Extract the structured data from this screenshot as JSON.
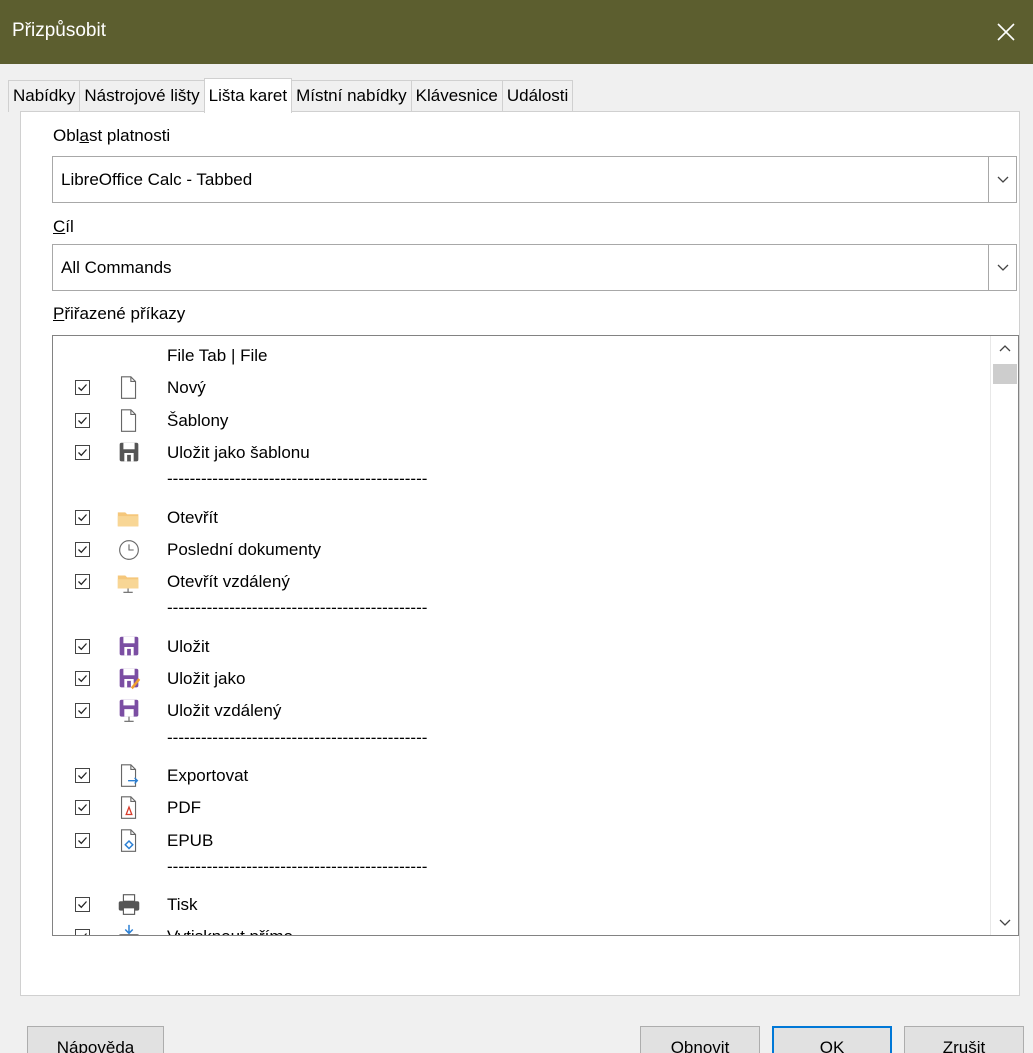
{
  "window": {
    "title": "Přizpůsobit"
  },
  "tabs": [
    "Nabídky",
    "Nástrojové lišty",
    "Lišta karet",
    "Místní nabídky",
    "Klávesnice",
    "Události"
  ],
  "active_tab": "Lišta karet",
  "scope": {
    "label_pre": "Obl",
    "label_u": "a",
    "label_post": "st platnosti",
    "value": "LibreOffice Calc -  Tabbed"
  },
  "target": {
    "label_u": "C",
    "label_post": "íl",
    "value": "All Commands"
  },
  "assigned": {
    "label_u": "P",
    "label_post": "řiřazené příkazy"
  },
  "commands": [
    {
      "type": "header",
      "label": "File Tab | File"
    },
    {
      "type": "item",
      "label": "Nový",
      "icon": "new-document-icon",
      "checked": true
    },
    {
      "type": "item",
      "label": "Šablony",
      "icon": "templates-icon",
      "checked": true
    },
    {
      "type": "item",
      "label": "Uložit jako šablonu",
      "icon": "save-as-template-icon",
      "checked": true
    },
    {
      "type": "separator",
      "label": "----------------------------------------------"
    },
    {
      "type": "item",
      "label": "Otevřít",
      "icon": "open-folder-icon",
      "checked": true
    },
    {
      "type": "item",
      "label": "Poslední dokumenty",
      "icon": "recent-clock-icon",
      "checked": true
    },
    {
      "type": "item",
      "label": "Otevřít vzdálený",
      "icon": "open-remote-icon",
      "checked": true
    },
    {
      "type": "separator",
      "label": "----------------------------------------------"
    },
    {
      "type": "item",
      "label": "Uložit",
      "icon": "save-icon",
      "checked": true
    },
    {
      "type": "item",
      "label": "Uložit jako",
      "icon": "save-as-icon",
      "checked": true
    },
    {
      "type": "item",
      "label": "Uložit vzdálený",
      "icon": "save-remote-icon",
      "checked": true
    },
    {
      "type": "separator",
      "label": "----------------------------------------------"
    },
    {
      "type": "item",
      "label": "Exportovat",
      "icon": "export-icon",
      "checked": true
    },
    {
      "type": "item",
      "label": "PDF",
      "icon": "pdf-icon",
      "checked": true
    },
    {
      "type": "item",
      "label": "EPUB",
      "icon": "epub-icon",
      "checked": true
    },
    {
      "type": "separator",
      "label": "----------------------------------------------"
    },
    {
      "type": "item",
      "label": "Tisk",
      "icon": "print-icon",
      "checked": true
    },
    {
      "type": "item",
      "label": "Vytisknout přímo",
      "icon": "print-direct-icon",
      "checked": true
    }
  ],
  "buttons": {
    "help": {
      "u": "N",
      "rest": "ápověda"
    },
    "reset": {
      "pre": "O",
      "u": "b",
      "rest": "novit"
    },
    "ok": {
      "u": "O",
      "rest": "K"
    },
    "cancel": {
      "u": "Z",
      "rest": "rušit"
    }
  },
  "colors": {
    "titlebar": "#5c5e2f",
    "save_purple": "#7b4ea3",
    "folder": "#f5c77b",
    "accent": "#0078d7"
  }
}
